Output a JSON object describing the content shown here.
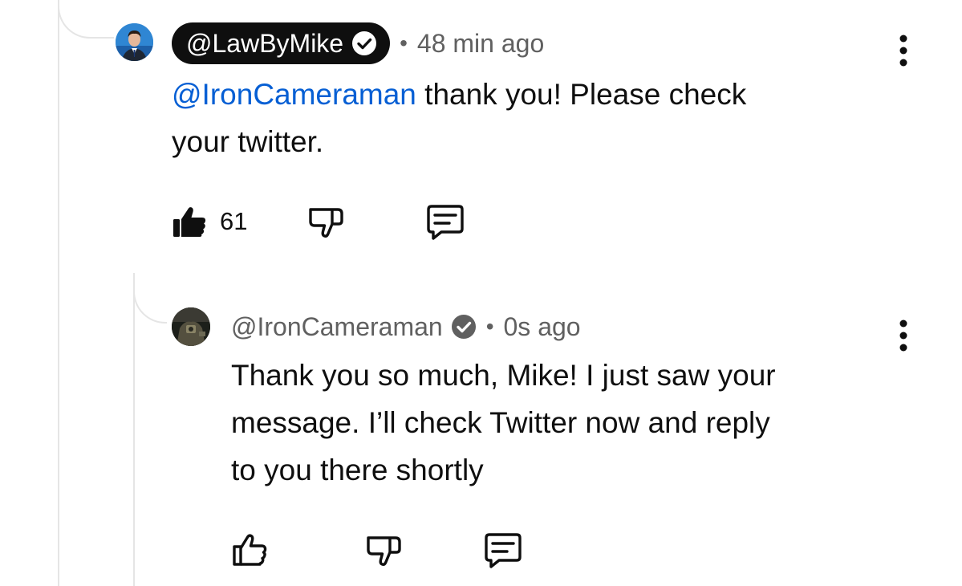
{
  "comment": {
    "author_handle": "@LawByMike",
    "separator": "•",
    "time": "48 min ago",
    "mention": "@IronCameraman",
    "text_line1": " thank you! Please check",
    "text_line2": "your twitter.",
    "like_count": "61",
    "avatar_icon": "profile-photo-icon",
    "verified_icon": "verified-check-icon",
    "menu_icon": "three-dots-vertical-icon"
  },
  "reply": {
    "author_handle": "@IronCameraman",
    "separator": "•",
    "time": "0s ago",
    "text_line1": "Thank you so much, Mike! I just saw your",
    "text_line2": "message. I’ll check Twitter now and reply",
    "text_line3": "to you there shortly",
    "avatar_icon": "profile-photo-icon",
    "verified_icon": "verified-check-icon",
    "menu_icon": "three-dots-vertical-icon"
  },
  "icons": {
    "like": "thumbs-up-icon",
    "dislike": "thumbs-down-icon",
    "reply": "reply-comment-icon"
  },
  "colors": {
    "mention_link": "#065fd4",
    "secondary_text": "#606060",
    "handle_pill_bg": "#0f0f0f",
    "thread_line": "#e5e5e5"
  }
}
